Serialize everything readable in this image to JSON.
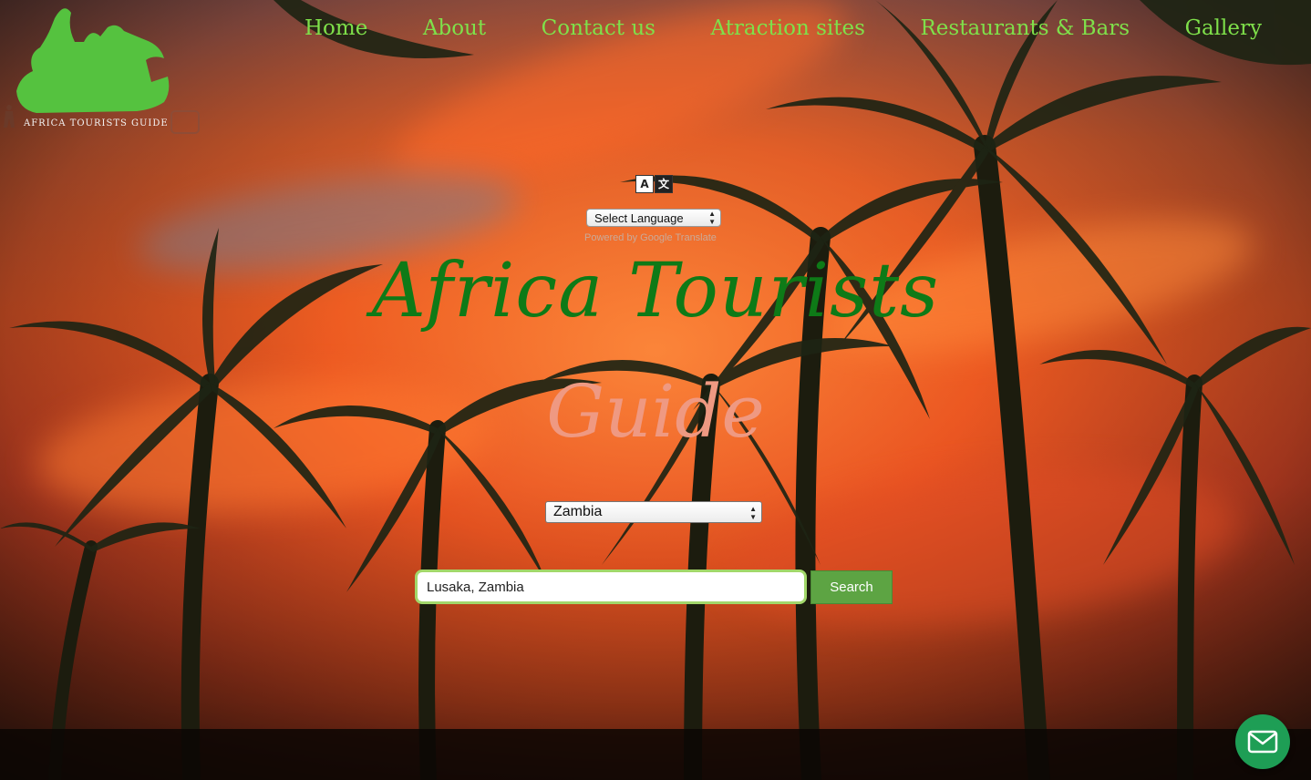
{
  "logo": {
    "text": "AFRICA TOURISTS GUIDE",
    "icon": "africa-animals-logo-icon",
    "color": "#55c23f"
  },
  "nav": {
    "items": [
      {
        "label": "Home"
      },
      {
        "label": "About"
      },
      {
        "label": "Contact us"
      },
      {
        "label": "Atraction sites"
      },
      {
        "label": "Restaurants & Bars"
      },
      {
        "label": "Gallery"
      }
    ],
    "color": "#7fe04a"
  },
  "translate": {
    "icon": "translate-icon",
    "select_label": "Select Language",
    "powered_by": "Powered by Google Translate"
  },
  "hero": {
    "title_line1": "Africa Tourists",
    "title_line2": "Guide",
    "title_line1_color": "#0e7a17",
    "title_line2_color": "#ef9982"
  },
  "country_select": {
    "selected": "Zambia"
  },
  "search": {
    "value": "Lusaka, Zambia",
    "button_label": "Search"
  },
  "mail_fab": {
    "icon": "mail-icon",
    "color": "#1e9e55"
  }
}
